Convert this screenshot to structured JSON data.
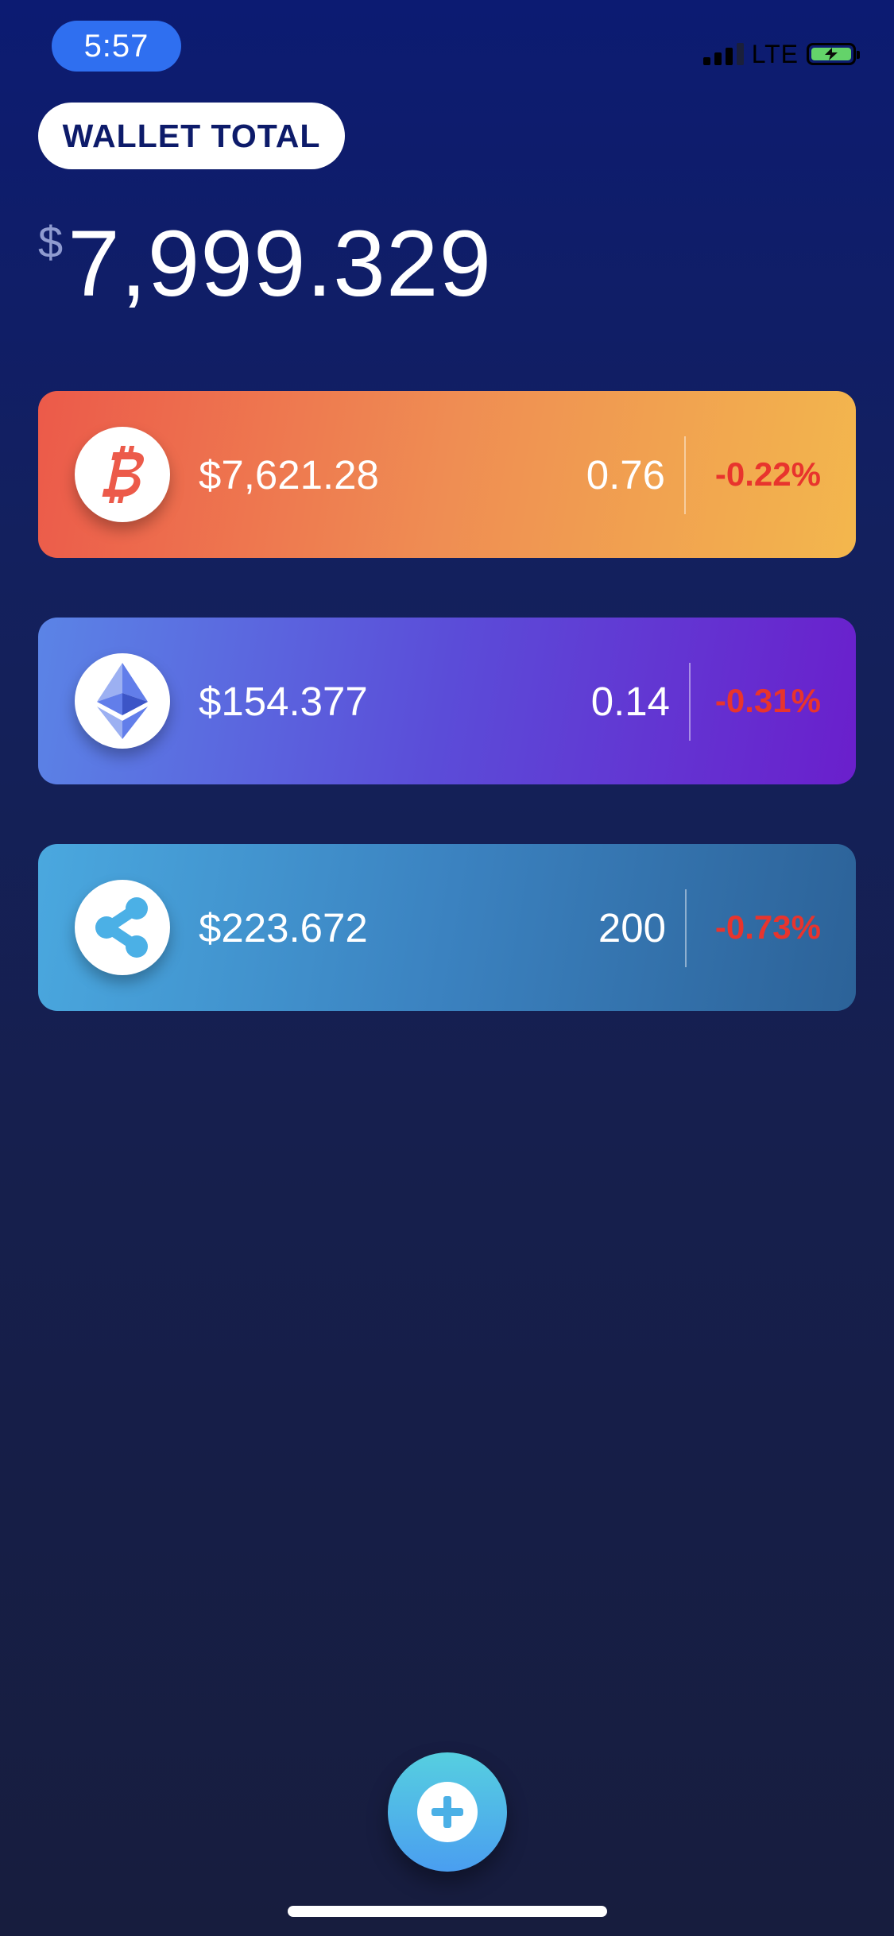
{
  "status_bar": {
    "time": "5:57",
    "network": "LTE"
  },
  "wallet": {
    "label": "WALLET TOTAL",
    "currency_symbol": "$",
    "total": "7,999.329"
  },
  "coins": [
    {
      "icon": "bitcoin-icon",
      "price": "$7,621.28",
      "quantity": "0.76",
      "change": "-0.22%"
    },
    {
      "icon": "ethereum-icon",
      "price": "$154.377",
      "quantity": "0.14",
      "change": "-0.31%"
    },
    {
      "icon": "ripple-icon",
      "price": "$223.672",
      "quantity": "200",
      "change": "-0.73%"
    }
  ],
  "colors": {
    "negative_change": "#e8342d",
    "time_pill": "#2f6ff0",
    "wallet_label_text": "#0d1b6a",
    "bitcoin": "#ec5a4a",
    "ethereum_icon": "#627eea",
    "ripple_icon": "#4bb0e6"
  },
  "actions": {
    "add_icon": "plus-icon"
  }
}
